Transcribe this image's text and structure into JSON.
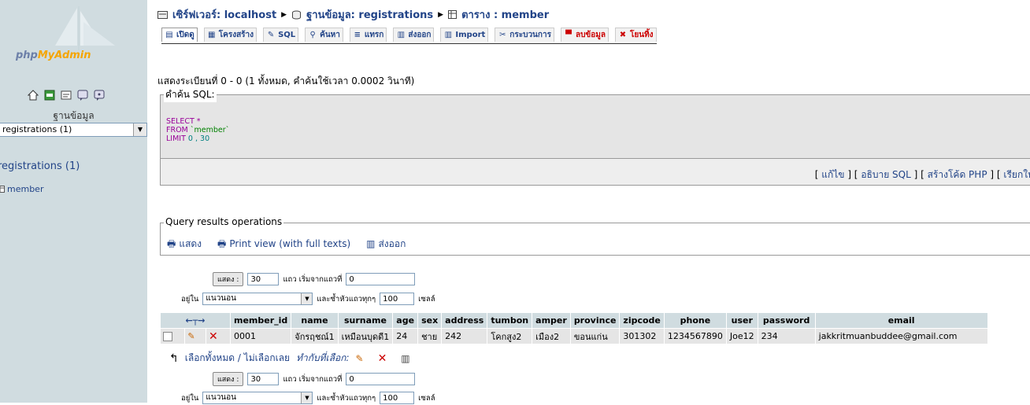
{
  "sidebar": {
    "logo_a": "php",
    "logo_b": "MyAdmin",
    "icons": [
      "home-icon",
      "exit-icon",
      "sql-icon",
      "docs-icon",
      "help-icon"
    ],
    "db_label": "ฐานข้อมูล",
    "db_select": "registrations (1)",
    "db_title": "registrations (1)",
    "table_link": "member"
  },
  "breadcrumb": {
    "server": "เซิร์ฟเวอร์: localhost",
    "database": "ฐานข้อมูล: registrations",
    "table": "ตาราง : member"
  },
  "tabs": [
    {
      "label": "เปิดดู",
      "icon": "browse-icon"
    },
    {
      "label": "โครงสร้าง",
      "icon": "structure-icon"
    },
    {
      "label": "SQL",
      "icon": "sql-icon"
    },
    {
      "label": "ค้นหา",
      "icon": "search-icon"
    },
    {
      "label": "แทรก",
      "icon": "insert-icon"
    },
    {
      "label": "ส่งออก",
      "icon": "export-icon"
    },
    {
      "label": "Import",
      "icon": "import-icon"
    },
    {
      "label": "กระบวนการ",
      "icon": "operations-icon"
    },
    {
      "label": "ลบข้อมูล",
      "icon": "empty-icon"
    },
    {
      "label": "โยนทิ้ง",
      "icon": "drop-icon"
    }
  ],
  "showing": "แสดงระเบียนที่ 0 - 0 (1 ทั้งหมด, คำค้นใช้เวลา 0.0002 วินาที)",
  "sql": {
    "legend": "คำค้น SQL:",
    "line1_kw": "SELECT",
    "line1_rest": " *",
    "line2_kw": "FROM",
    "line2_rest": " `member`",
    "line3_kw": "LIMIT",
    "line3_rest": " 0 , 30",
    "links": [
      "แก้ไข",
      "อธิบาย SQL",
      "สร้างโค้ด PHP",
      "เรียกให"
    ]
  },
  "ops": {
    "legend": "Query results operations",
    "print": "แสดง",
    "print_full": "Print view (with full texts)",
    "export": "ส่งออก"
  },
  "nav": {
    "show_btn": "แสดง :",
    "rows": "30",
    "rows_from": "แถว เริ่มจากแถวที่",
    "start": "0",
    "in_label": "อยู่ใน",
    "mode": "แนวนอน",
    "repeat_label": "และซ้ำหัวแถวทุกๆ",
    "repeat": "100",
    "cells": "เซลล์"
  },
  "table": {
    "columns": [
      "member_id",
      "name",
      "surname",
      "age",
      "sex",
      "address",
      "tumbon",
      "amper",
      "province",
      "zipcode",
      "phone",
      "user",
      "password",
      "email"
    ],
    "rows": [
      [
        "0001",
        "จักรฤชณ์1",
        "เหมือนบุดดี1",
        "24",
        "ชาย",
        "242",
        "โคกสูง2",
        "เมือง2",
        "ขอนแก่น",
        "301302",
        "1234567890",
        "Joe12",
        "234",
        "jakkritmuanbuddee@gmail.com"
      ]
    ]
  },
  "bulk": {
    "label": "เลือกทั้งหมด / ไม่เลือกเลย",
    "with_selected": "ทำกับที่เลือก:"
  }
}
